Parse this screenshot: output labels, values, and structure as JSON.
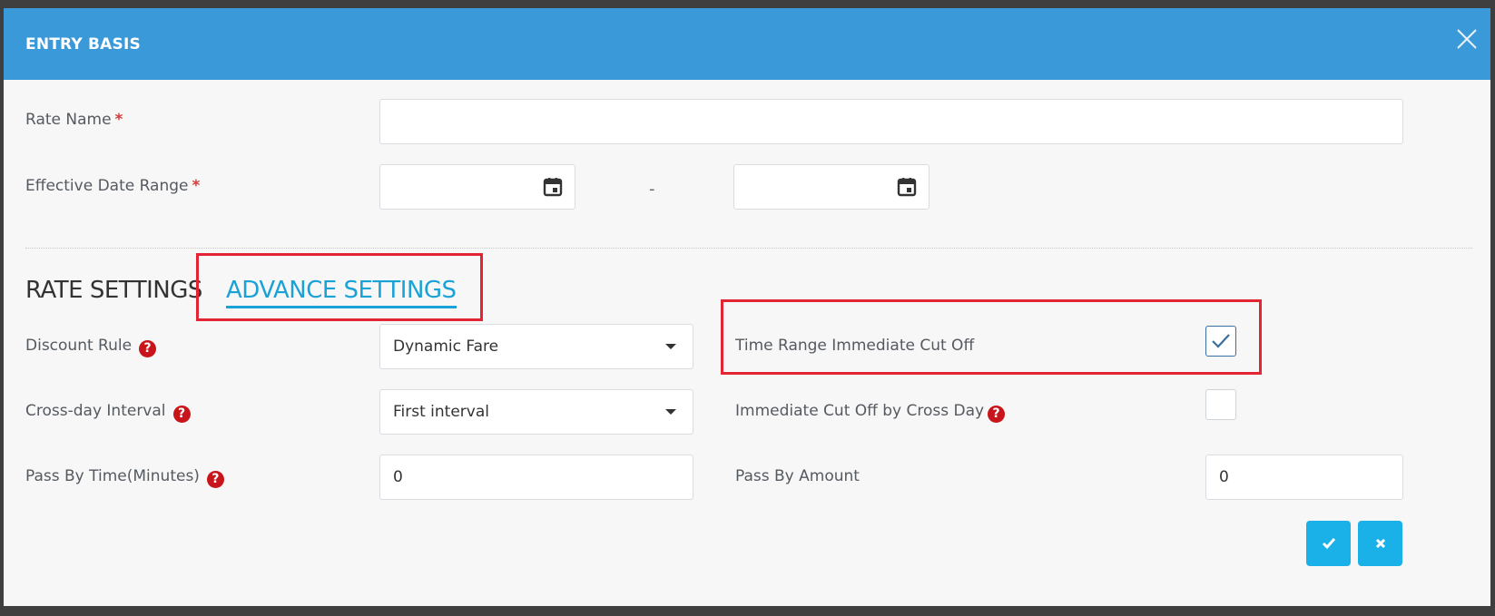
{
  "modal": {
    "title": "ENTRY BASIS",
    "close_icon": "close-icon"
  },
  "form": {
    "rate_name": {
      "label": "Rate Name",
      "required_mark": "*",
      "value": ""
    },
    "effective_date_range": {
      "label": "Effective Date Range",
      "required_mark": "*",
      "start_value": "",
      "end_value": "",
      "separator": "-",
      "icon": "calendar-icon"
    }
  },
  "tabs": {
    "rate_settings": "RATE SETTINGS",
    "advance_settings": "ADVANCE SETTINGS",
    "active": "advance_settings"
  },
  "settings": {
    "discount_rule": {
      "label": "Discount Rule",
      "value": "Dynamic Fare",
      "help": "?"
    },
    "cross_day_interval": {
      "label": "Cross-day Interval",
      "value": "First interval",
      "help": "?"
    },
    "pass_by_time": {
      "label": "Pass By Time(Minutes)",
      "value": "0",
      "help": "?"
    },
    "time_range_cutoff": {
      "label": "Time Range Immediate Cut Off",
      "checked": true
    },
    "cutoff_by_cross_day": {
      "label": "Immediate Cut Off by Cross Day",
      "checked": false,
      "help": "?"
    },
    "pass_by_amount": {
      "label": "Pass By Amount",
      "value": "0"
    }
  },
  "actions": {
    "confirm_icon": "check-icon",
    "cancel_icon": "x-icon"
  },
  "colors": {
    "header": "#3a99d8",
    "accent": "#1aa2d6",
    "highlight": "#e32432",
    "help": "#c8151b",
    "button": "#1ab0e8"
  }
}
